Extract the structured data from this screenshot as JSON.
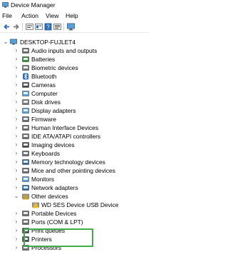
{
  "window": {
    "title": "Device Manager",
    "icon": "device-manager-icon"
  },
  "menu": [
    "File",
    "Action",
    "View",
    "Help"
  ],
  "toolbar": [
    "back-arrow-icon",
    "forward-arrow-icon",
    "properties-icon",
    "show-hidden-icon",
    "help-icon",
    "monitor-icon"
  ],
  "tree": {
    "root": {
      "label": "DESKTOP-FUJLET4",
      "expanded": true
    },
    "items": [
      {
        "label": "Audio inputs and outputs",
        "icon": "speaker-icon",
        "expanded": false
      },
      {
        "label": "Batteries",
        "icon": "battery-icon",
        "expanded": false
      },
      {
        "label": "Biometric devices",
        "icon": "biometric-icon",
        "expanded": false
      },
      {
        "label": "Bluetooth",
        "icon": "bluetooth-icon",
        "expanded": false
      },
      {
        "label": "Cameras",
        "icon": "camera-icon",
        "expanded": false
      },
      {
        "label": "Computer",
        "icon": "computer-icon",
        "expanded": false
      },
      {
        "label": "Disk drives",
        "icon": "disk-icon",
        "expanded": false
      },
      {
        "label": "Display adapters",
        "icon": "display-icon",
        "expanded": false
      },
      {
        "label": "Firmware",
        "icon": "firmware-icon",
        "expanded": false
      },
      {
        "label": "Human Interface Devices",
        "icon": "hid-icon",
        "expanded": false
      },
      {
        "label": "IDE ATA/ATAPI controllers",
        "icon": "ide-icon",
        "expanded": false
      },
      {
        "label": "Imaging devices",
        "icon": "imaging-icon",
        "expanded": false
      },
      {
        "label": "Keyboards",
        "icon": "keyboard-icon",
        "expanded": false
      },
      {
        "label": "Memory technology devices",
        "icon": "memory-icon",
        "expanded": false
      },
      {
        "label": "Mice and other pointing devices",
        "icon": "mouse-icon",
        "expanded": false
      },
      {
        "label": "Monitors",
        "icon": "monitor-icon",
        "expanded": false
      },
      {
        "label": "Network adapters",
        "icon": "network-icon",
        "expanded": false
      },
      {
        "label": "Other devices",
        "icon": "other-devices-icon",
        "expanded": true
      },
      {
        "label": "WD SES Device USB Device",
        "icon": "unknown-device-icon",
        "child": true
      },
      {
        "label": "Portable Devices",
        "icon": "portable-icon",
        "expanded": false
      },
      {
        "label": "Ports (COM & LPT)",
        "icon": "port-icon",
        "expanded": false
      },
      {
        "label": "Print queues",
        "icon": "print-queue-icon",
        "expanded": false
      },
      {
        "label": "Printers",
        "icon": "printer-icon",
        "expanded": false
      },
      {
        "label": "Processors",
        "icon": "processor-icon",
        "expanded": false
      }
    ]
  },
  "colors": {
    "highlight": "#3fae49",
    "icon_blue": "#2b6cb0"
  }
}
